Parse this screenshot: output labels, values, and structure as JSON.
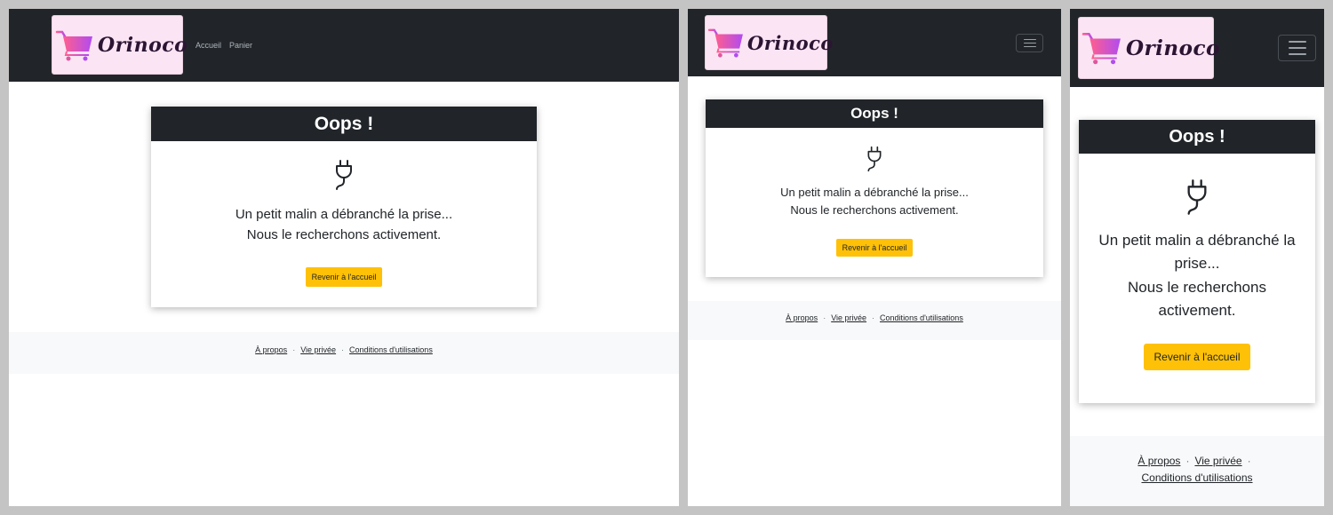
{
  "brand": {
    "name": "Orinoco"
  },
  "nav": {
    "home": "Accueil",
    "cart": "Panier"
  },
  "error": {
    "title": "Oops !",
    "line1": "Un petit malin a débranché la prise...",
    "line2": "Nous le recherchons activement.",
    "button": "Revenir à l'accueil"
  },
  "footer": {
    "about": "À propos",
    "privacy": "Vie privée",
    "terms": "Conditions d'utilisations",
    "separator": "·"
  },
  "colors": {
    "navbar": "#212529",
    "accent_button": "#ffc107",
    "brand_background": "#fbe4f4",
    "cart_gradient": [
      "#ff5e8e",
      "#b14cf0"
    ],
    "footer_background": "#f8f9fa",
    "outer_background": "#c4c4c4"
  },
  "icons": {
    "cart": "shopping-cart-icon",
    "plug": "plug-icon",
    "menu": "hamburger-menu-icon"
  }
}
